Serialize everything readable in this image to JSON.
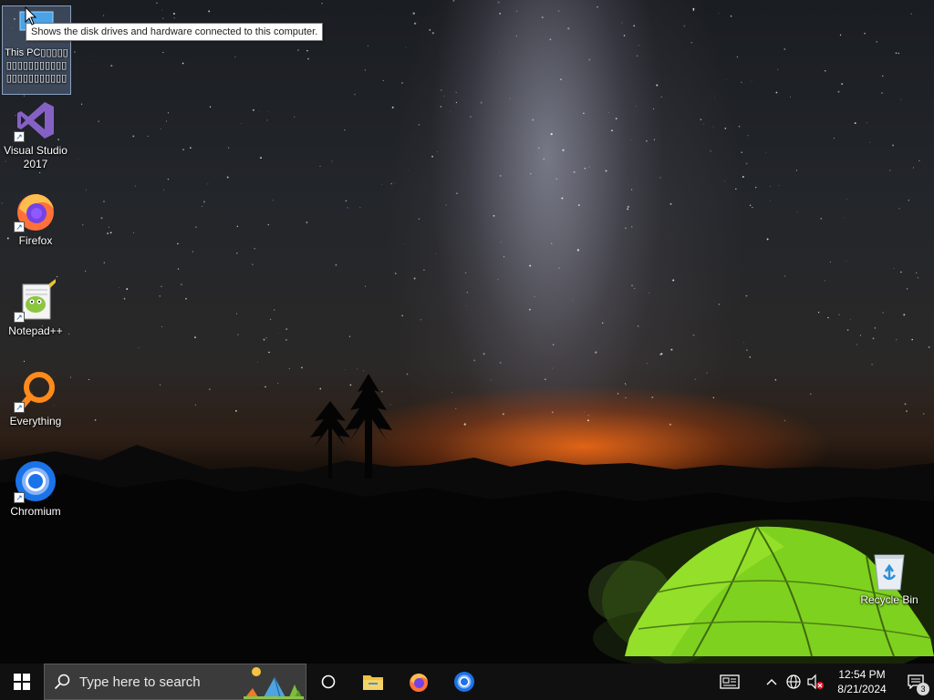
{
  "desktop": {
    "icons": [
      {
        "label": "This PC▯▯▯▯▯▯▯▯▯▯▯▯▯▯▯▯▯▯▯▯▯▯▯▯▯▯▯▯",
        "icon": "this-pc-icon",
        "selected": true
      },
      {
        "label": "Visual Studio 2017",
        "icon": "visual-studio-icon"
      },
      {
        "label": "Firefox",
        "icon": "firefox-icon"
      },
      {
        "label": "Notepad++",
        "icon": "notepad-plus-plus-icon"
      },
      {
        "label": "Everything",
        "icon": "everything-search-icon"
      },
      {
        "label": "Chromium",
        "icon": "chromium-icon"
      },
      {
        "label": "Recycle Bin",
        "icon": "recycle-bin-icon"
      }
    ],
    "tooltip": "Shows the disk drives and hardware connected to this computer."
  },
  "taskbar": {
    "search_placeholder": "Type here to search",
    "pinned": [
      "File Explorer",
      "Firefox",
      "Chromium"
    ],
    "tray": {
      "time": "12:54 PM",
      "date": "8/21/2024",
      "notification_count": "3"
    }
  },
  "colors": {
    "taskbar_bg": "#101010",
    "search_bg": "#3b3b3b",
    "accent_orange": "#ff6a14",
    "tent_green": "#7ed321"
  }
}
